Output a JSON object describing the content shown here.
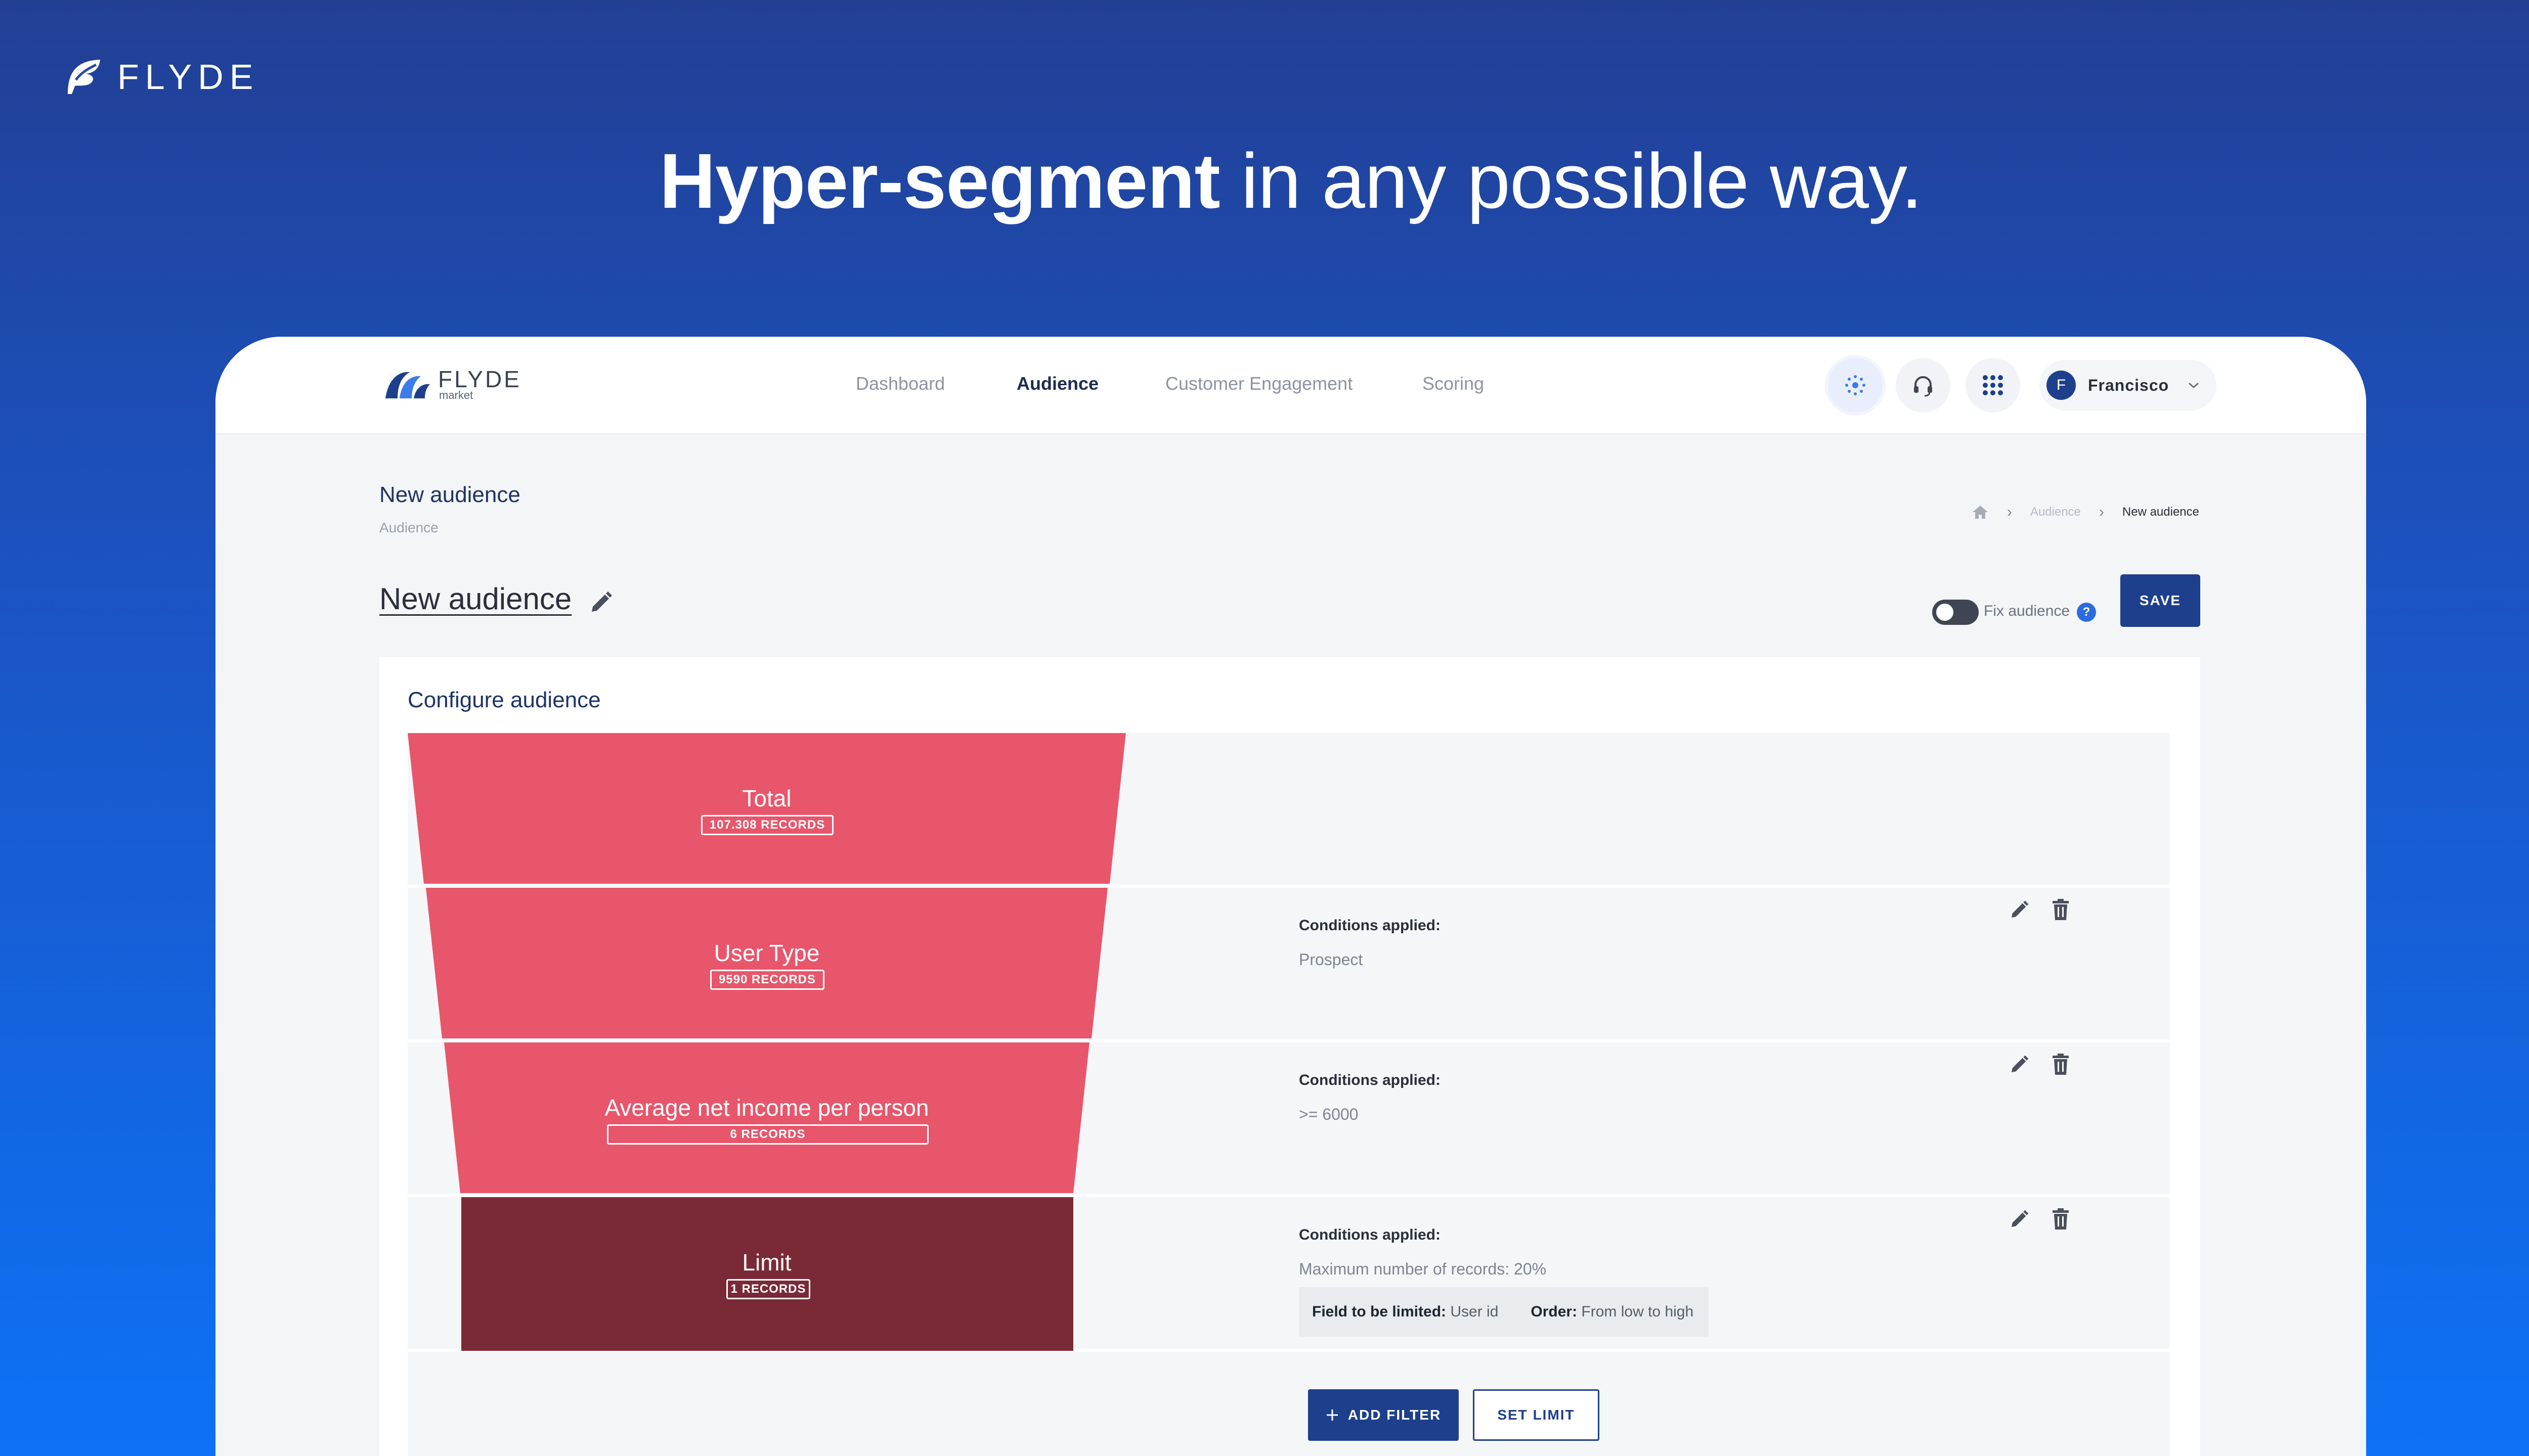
{
  "brand": {
    "name": "FLYDE"
  },
  "headline": {
    "bold": "Hyper-segment",
    "rest": " in any possible way."
  },
  "app": {
    "logo_name": "FLYDE",
    "logo_sub": "market",
    "nav": [
      "Dashboard",
      "Audience",
      "Customer Engagement",
      "Scoring"
    ],
    "active_nav": "Audience",
    "user": {
      "initial": "F",
      "name": "Francisco"
    }
  },
  "page": {
    "title": "New audience",
    "subtitle": "Audience",
    "breadcrumb": {
      "parent": "Audience",
      "current": "New audience"
    },
    "audience_name": "New audience",
    "fix_audience_label": "Fix audience",
    "help_glyph": "?",
    "save_label": "SAVE"
  },
  "configure": {
    "title": "Configure audience",
    "stages": [
      {
        "label": "Total",
        "records": "107.308 RECORDS",
        "color": "#e8566b"
      },
      {
        "label": "User Type",
        "records": "9590 RECORDS",
        "color": "#e8566b",
        "conditions_title": "Conditions applied:",
        "condition": "Prospect"
      },
      {
        "label": "Average net income per person",
        "records": "6 RECORDS",
        "color": "#e8566b",
        "conditions_title": "Conditions applied:",
        "condition": ">= 6000"
      },
      {
        "label": "Limit",
        "records": "1 RECORDS",
        "color": "#7a2a37",
        "conditions_title": "Conditions applied:",
        "condition": "Maximum number of records: 20%",
        "limit_field_label": "Field to be limited:",
        "limit_field_value": "User id",
        "order_label": "Order:",
        "order_value": "From low to high"
      }
    ],
    "add_filter_label": "ADD FILTER",
    "set_limit_label": "SET LIMIT"
  },
  "icons": {
    "nav_icons": [
      "ai-icon",
      "headset-icon",
      "apps-grid-icon"
    ],
    "row_icons": [
      "edit-icon",
      "trash-icon"
    ]
  },
  "colors": {
    "primary": "#1d3f8c",
    "funnel": "#e8566b",
    "limit": "#7a2a37"
  }
}
